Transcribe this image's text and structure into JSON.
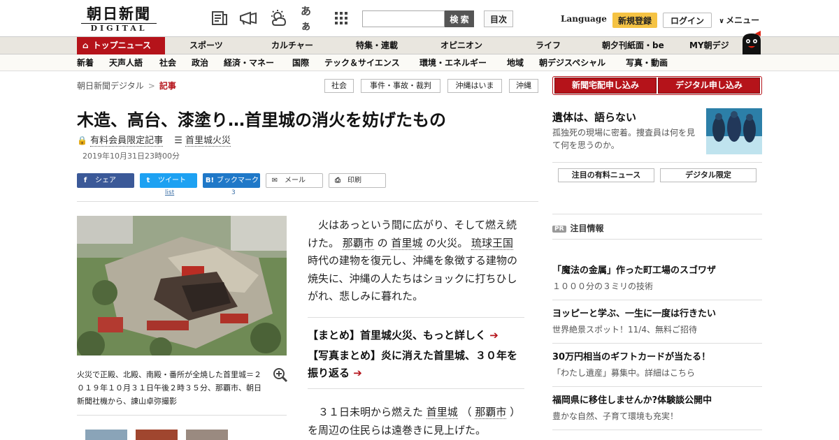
{
  "header": {
    "logo_jp": "朝日新聞",
    "logo_en": "DIGITAL",
    "icons": [
      "newspaper-icon",
      "megaphone-icon",
      "weather-icon",
      "font-size-icon",
      "apps-grid-icon"
    ],
    "font_icon_text": "あぁ",
    "search_placeholder": "",
    "search_button": "検 索",
    "index_button": "目次",
    "language": "Language",
    "register": "新規登録",
    "login": "ログイン",
    "menu": "メニュー"
  },
  "nav_primary": [
    {
      "label": "トップニュース",
      "active": true
    },
    {
      "label": "スポーツ"
    },
    {
      "label": "カルチャー"
    },
    {
      "label": "特集・連載"
    },
    {
      "label": "オピニオン"
    },
    {
      "label": "ライフ"
    },
    {
      "label": "朝夕刊紙面・be"
    },
    {
      "label": "MY朝デジ"
    }
  ],
  "nav_secondary": [
    "新着",
    "天声人語",
    "社会",
    "政治",
    "経済・マネー",
    "国際",
    "テック＆サイエンス",
    "環境・エネルギー",
    "地域",
    "朝デジスペシャル",
    "写真・動画"
  ],
  "breadcrumb": {
    "home": "朝日新聞デジタル",
    "separator": ">",
    "current": "記事"
  },
  "tags": [
    "社会",
    "事件・事故・裁判",
    "沖縄はいま",
    "沖縄"
  ],
  "article": {
    "title": "木造、高台、漆塗り…首里城の消火を妨げたもの",
    "lock_label": "有料会員限定記事",
    "series_label": "首里城火災",
    "date": "2019年10月31日23時00分",
    "share": [
      {
        "label": "シェア",
        "icon": "f"
      },
      {
        "label": "ツイート",
        "icon": "t",
        "count": "list"
      },
      {
        "label": "ブックマーク",
        "icon": "B!",
        "count": "3"
      },
      {
        "label": "メール",
        "icon": "✉"
      },
      {
        "label": "印刷",
        "icon": "⎙"
      }
    ],
    "caption": "火災で正殿、北殿、南殿・番所が全焼した首里城＝２０１９年１０月３１日午後２時３５分、那覇市、朝日新聞社機から、諌山卓弥撮影",
    "lead_parts": [
      "火はあっという間に広がり、そして燃え続けた。",
      "那覇市",
      "の",
      "首里城",
      "の火災。",
      "琉球王国",
      "時代の建物を復元し、沖縄を象徴する建物の焼失に、沖縄の人たちはショックに打ちひしがれ、悲しみに暮れた。"
    ],
    "related": [
      "【まとめ】首里城火災、もっと詳しく",
      "【写真まとめ】炎に消えた首里城、３０年を振り返る"
    ],
    "body2_parts": [
      "３１日未明から燃えた",
      "首里城",
      "（",
      "那覇市",
      "）を周辺の住民らは遠巻きに見上げた。"
    ]
  },
  "sidebar": {
    "subscribe": [
      "新聞宅配申し込み",
      "デジタル申し込み"
    ],
    "feature_title": "遺体は、語らない",
    "feature_sub": "孤独死の現場に密着。捜査員は何を見て何を思うのか。",
    "buttons": [
      "注目の有料ニュース",
      "デジタル限定"
    ],
    "pr_badge": "PR",
    "pr_label": "注目情報",
    "ads": [
      {
        "title": "「魔法の金属」作った町工場のスゴワザ",
        "sub": "１０００分の３ミリの技術"
      },
      {
        "title": "ヨッピーと学ぶ、一生に一度は行きたい",
        "sub": "世界絶景スポット！11/4、無料ご招待"
      },
      {
        "title": "30万円相当のギフトカードが当たる！",
        "sub": "「わたし遺産」募集中。詳細はこちら"
      },
      {
        "title": "福岡県に移住しませんか?体験談公開中",
        "sub": "豊かな自然、子育て環境も充実！"
      }
    ]
  },
  "colors": {
    "brand_red": "#b5131a",
    "register_yellow": "#f5c344",
    "facebook": "#3b5998",
    "twitter": "#1da1f2",
    "hatena": "#1f78c8"
  }
}
